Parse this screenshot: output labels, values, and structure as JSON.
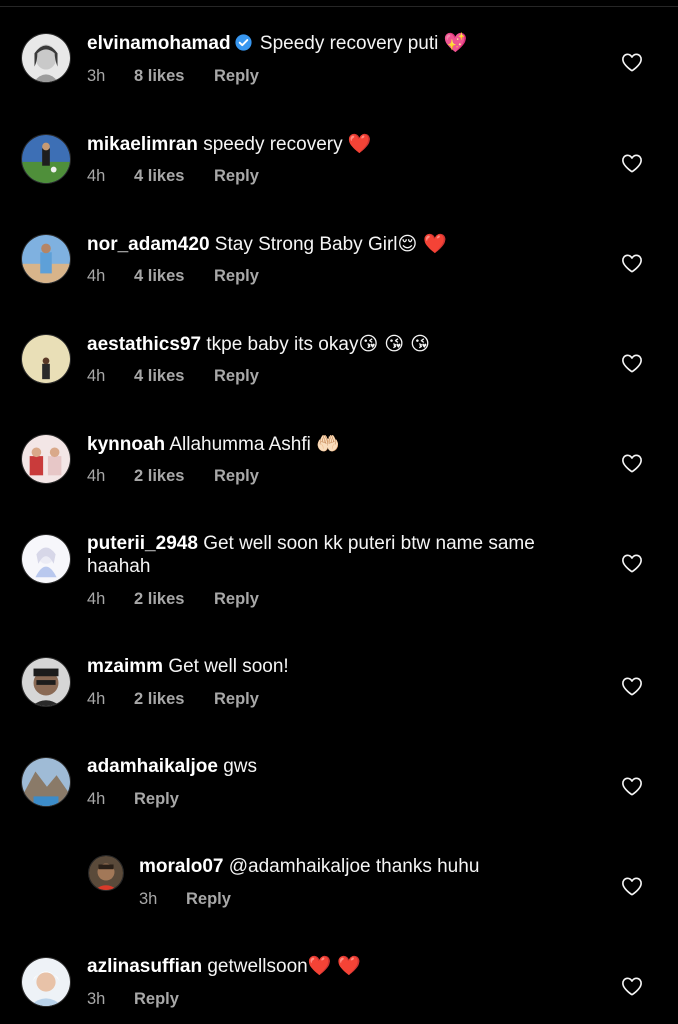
{
  "comments": [
    {
      "username": "elvinamohamad",
      "verified": true,
      "text": "Speedy recovery puti",
      "emoji": "💖",
      "time": "3h",
      "likes": "8 likes",
      "reply": "Reply"
    },
    {
      "username": "mikaelimran",
      "text": "speedy recovery",
      "emoji": "❤️",
      "time": "4h",
      "likes": "4 likes",
      "reply": "Reply"
    },
    {
      "username": "nor_adam420",
      "text": "Stay Strong Baby Girl",
      "emoji": "😌 ❤️",
      "time": "4h",
      "likes": "4 likes",
      "reply": "Reply"
    },
    {
      "username": "aestathics97",
      "text": "tkpe baby its okay",
      "emoji": "😘 😘 😘",
      "time": "4h",
      "likes": "4 likes",
      "reply": "Reply"
    },
    {
      "username": "kynnoah",
      "text": "Allahumma Ashfi",
      "emoji": "🤲🏻",
      "time": "4h",
      "likes": "2 likes",
      "reply": "Reply"
    },
    {
      "username": "puterii_2948",
      "text": "Get well soon kk puteri btw name same",
      "text2": "haahah",
      "time": "4h",
      "likes": "2 likes",
      "reply": "Reply"
    },
    {
      "username": "mzaimm",
      "text": "Get well soon!",
      "time": "4h",
      "likes": "2 likes",
      "reply": "Reply"
    },
    {
      "username": "adamhaikaljoe",
      "text": "gws",
      "time": "4h",
      "reply": "Reply"
    },
    {
      "username": "moralo07",
      "text": "@adamhaikaljoe thanks huhu",
      "time": "3h",
      "reply": "Reply"
    },
    {
      "username": "azlinasuffian",
      "text": "getwellsoon",
      "emoji": "❤️ ❤️",
      "time": "3h",
      "reply": "Reply"
    }
  ],
  "icons": {
    "like": "heart-outline-icon",
    "verified": "verified-badge-icon"
  },
  "colors": {
    "background": "#000000",
    "text": "#f5f5f5",
    "secondary": "#a8a8a8",
    "verified": "#3897f0"
  }
}
